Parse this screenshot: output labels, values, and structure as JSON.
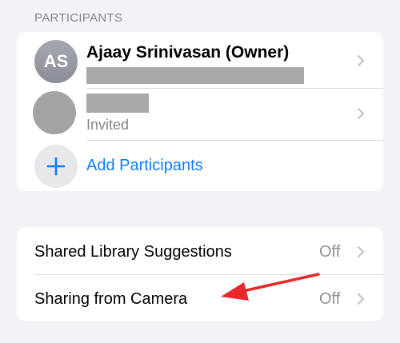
{
  "participants_header": "PARTICIPANTS",
  "participants": [
    {
      "initials": "AS",
      "name": "Ajaay Srinivasan (Owner)"
    },
    {
      "status": "Invited"
    }
  ],
  "add_participants_label": "Add Participants",
  "settings": [
    {
      "label": "Shared Library Suggestions",
      "value": "Off"
    },
    {
      "label": "Sharing from Camera",
      "value": "Off"
    }
  ],
  "colors": {
    "accent": "#0a7aff",
    "annotation_arrow": "#e8262b"
  },
  "icons": [
    "chevron-right-icon",
    "plus-icon"
  ]
}
